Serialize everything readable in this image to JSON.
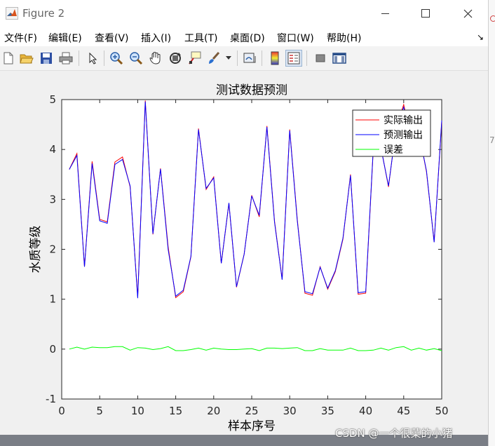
{
  "window": {
    "title": "Figure 2"
  },
  "menu": [
    "文件(F)",
    "编辑(E)",
    "查看(V)",
    "插入(I)",
    "工具(T)",
    "桌面(D)",
    "窗口(W)",
    "帮助(H)"
  ],
  "toolbar_icons": [
    "new-figure-icon",
    "open-file-icon",
    "save-icon",
    "print-icon",
    "select-pointer-icon",
    "zoom-in-icon",
    "zoom-out-icon",
    "pan-hand-icon",
    "rotate-3d-icon",
    "data-cursor-icon",
    "brush-icon",
    "brush-dropdown-icon",
    "link-plot-icon",
    "insert-colorbar-icon",
    "insert-legend-icon",
    "hide-plot-tools-icon",
    "show-plot-tools-icon"
  ],
  "watermark": "CSDN @一个很菜的小猪",
  "outside_digit": "7",
  "colors": {
    "actual": "#ff0000",
    "predicted": "#0000ff",
    "error": "#00ff00"
  },
  "chart_data": {
    "type": "line",
    "title": "测试数据预测",
    "xlabel": "样本序号",
    "ylabel": "水质等级",
    "xlim": [
      0,
      50
    ],
    "ylim": [
      -1,
      5
    ],
    "xticks": [
      0,
      5,
      10,
      15,
      20,
      25,
      30,
      35,
      40,
      45,
      50
    ],
    "yticks": [
      -1,
      0,
      1,
      2,
      3,
      4,
      5
    ],
    "legend_position": "top-right",
    "x": [
      1,
      2,
      3,
      4,
      5,
      6,
      7,
      8,
      9,
      10,
      11,
      12,
      13,
      14,
      15,
      16,
      17,
      18,
      19,
      20,
      21,
      22,
      23,
      24,
      25,
      26,
      27,
      28,
      29,
      30,
      31,
      32,
      33,
      34,
      35,
      36,
      37,
      38,
      39,
      40,
      41,
      42,
      43,
      44,
      45,
      46,
      47,
      48,
      49,
      50
    ],
    "series": [
      {
        "name": "实际输出",
        "color": "#ff0000",
        "values": [
          3.6,
          3.92,
          1.65,
          3.76,
          2.6,
          2.55,
          3.75,
          3.85,
          3.25,
          1.05,
          4.98,
          2.3,
          3.62,
          2.05,
          1.03,
          1.15,
          1.85,
          4.42,
          3.2,
          3.45,
          1.72,
          2.92,
          1.24,
          1.9,
          3.08,
          2.65,
          4.47,
          2.57,
          1.4,
          4.4,
          2.6,
          1.12,
          1.08,
          1.65,
          1.2,
          1.55,
          2.2,
          3.5,
          1.1,
          1.12,
          4.0,
          4.05,
          3.25,
          4.45,
          4.9,
          4.2,
          4.35,
          3.55,
          2.15,
          4.55
        ]
      },
      {
        "name": "预测输出",
        "color": "#0000ff",
        "values": [
          3.6,
          3.88,
          1.65,
          3.72,
          2.57,
          2.52,
          3.7,
          3.8,
          3.27,
          1.02,
          4.96,
          2.31,
          3.61,
          2.0,
          1.06,
          1.18,
          1.86,
          4.4,
          3.22,
          3.43,
          1.72,
          2.93,
          1.25,
          1.9,
          3.07,
          2.68,
          4.45,
          2.55,
          1.39,
          4.38,
          2.57,
          1.15,
          1.11,
          1.64,
          1.22,
          1.57,
          2.22,
          3.48,
          1.13,
          1.15,
          4.02,
          4.03,
          3.27,
          4.42,
          4.85,
          4.22,
          4.33,
          3.57,
          2.14,
          4.58
        ]
      },
      {
        "name": "误差",
        "color": "#00ff00",
        "values": [
          0.0,
          0.04,
          0.0,
          0.04,
          0.03,
          0.03,
          0.05,
          0.05,
          -0.02,
          0.03,
          0.02,
          -0.01,
          0.01,
          0.05,
          -0.03,
          -0.03,
          -0.01,
          0.02,
          -0.02,
          0.02,
          0.0,
          -0.01,
          -0.01,
          0.0,
          0.01,
          -0.03,
          0.02,
          0.02,
          0.01,
          0.02,
          0.03,
          -0.03,
          -0.03,
          0.01,
          -0.02,
          -0.02,
          -0.02,
          0.02,
          -0.03,
          -0.03,
          -0.02,
          0.02,
          -0.02,
          0.03,
          0.05,
          -0.02,
          0.02,
          -0.02,
          0.01,
          -0.03
        ]
      }
    ]
  }
}
